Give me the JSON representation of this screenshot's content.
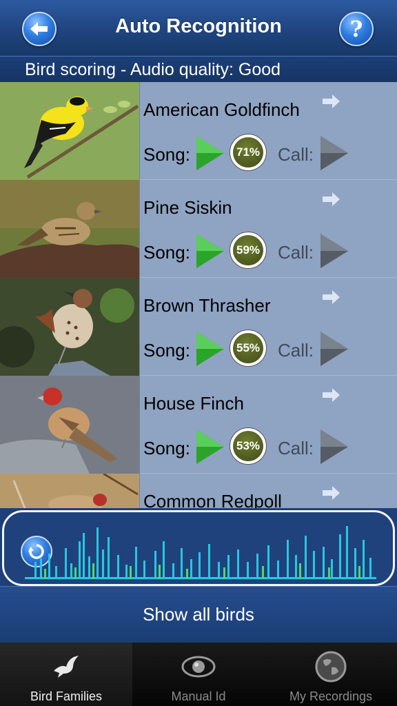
{
  "header": {
    "title": "Auto Recognition",
    "back_icon": "back-arrow-icon",
    "help_label": "?"
  },
  "quality_bar": {
    "text": "Bird scoring - Audio quality: Good"
  },
  "birds": [
    {
      "name": "American Goldfinch",
      "song_label": "Song:",
      "score": "71%",
      "call_label": "Call:"
    },
    {
      "name": "Pine Siskin",
      "song_label": "Song:",
      "score": "59%",
      "call_label": "Call:"
    },
    {
      "name": "Brown Thrasher",
      "song_label": "Song:",
      "score": "55%",
      "call_label": "Call:"
    },
    {
      "name": "House Finch",
      "song_label": "Song:",
      "score": "53%",
      "call_label": "Call:"
    },
    {
      "name": "Common Redpoll"
    }
  ],
  "waveform": {
    "refresh_icon": "refresh-icon"
  },
  "show_all_label": "Show all birds",
  "tabs": [
    {
      "label": "Bird Families",
      "icon": "bird-icon",
      "active": true
    },
    {
      "label": "Manual Id",
      "icon": "eye-icon",
      "active": false
    },
    {
      "label": "My Recordings",
      "icon": "globe-icon",
      "active": false
    }
  ],
  "colors": {
    "header_blue": "#1f447f",
    "list_bg": "#8fa3c2",
    "score_green": "#4f5a1e",
    "play_green": "#2aa52a",
    "wave_cyan": "#27c7e0"
  }
}
